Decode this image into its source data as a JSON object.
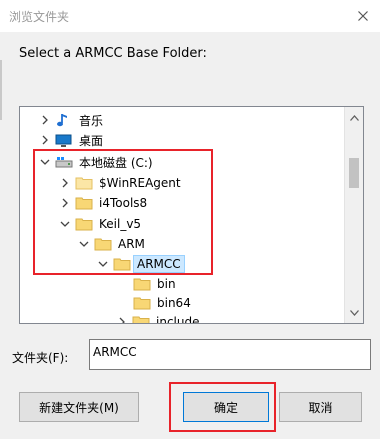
{
  "window": {
    "title": "浏览文件夹",
    "close_label": "✕"
  },
  "prompt": "Select a ARMCC Base Folder:",
  "tree": {
    "items": [
      {
        "label": "音乐"
      },
      {
        "label": "桌面"
      },
      {
        "label": "本地磁盘 (C:)"
      },
      {
        "label": "$WinREAgent"
      },
      {
        "label": "i4Tools8"
      },
      {
        "label": "Keil_v5"
      },
      {
        "label": "ARM"
      },
      {
        "label": "ARMCC"
      },
      {
        "label": "bin"
      },
      {
        "label": "bin64"
      },
      {
        "label": "include"
      }
    ]
  },
  "folder": {
    "label": "文件夹(F):",
    "value": "ARMCC"
  },
  "buttons": {
    "new_folder": "新建文件夹(M)",
    "ok": "确定",
    "cancel": "取消"
  },
  "colors": {
    "highlight_red": "#e8232a",
    "selection_bg": "#cce8ff",
    "folder_yellow": "#f8d775"
  }
}
